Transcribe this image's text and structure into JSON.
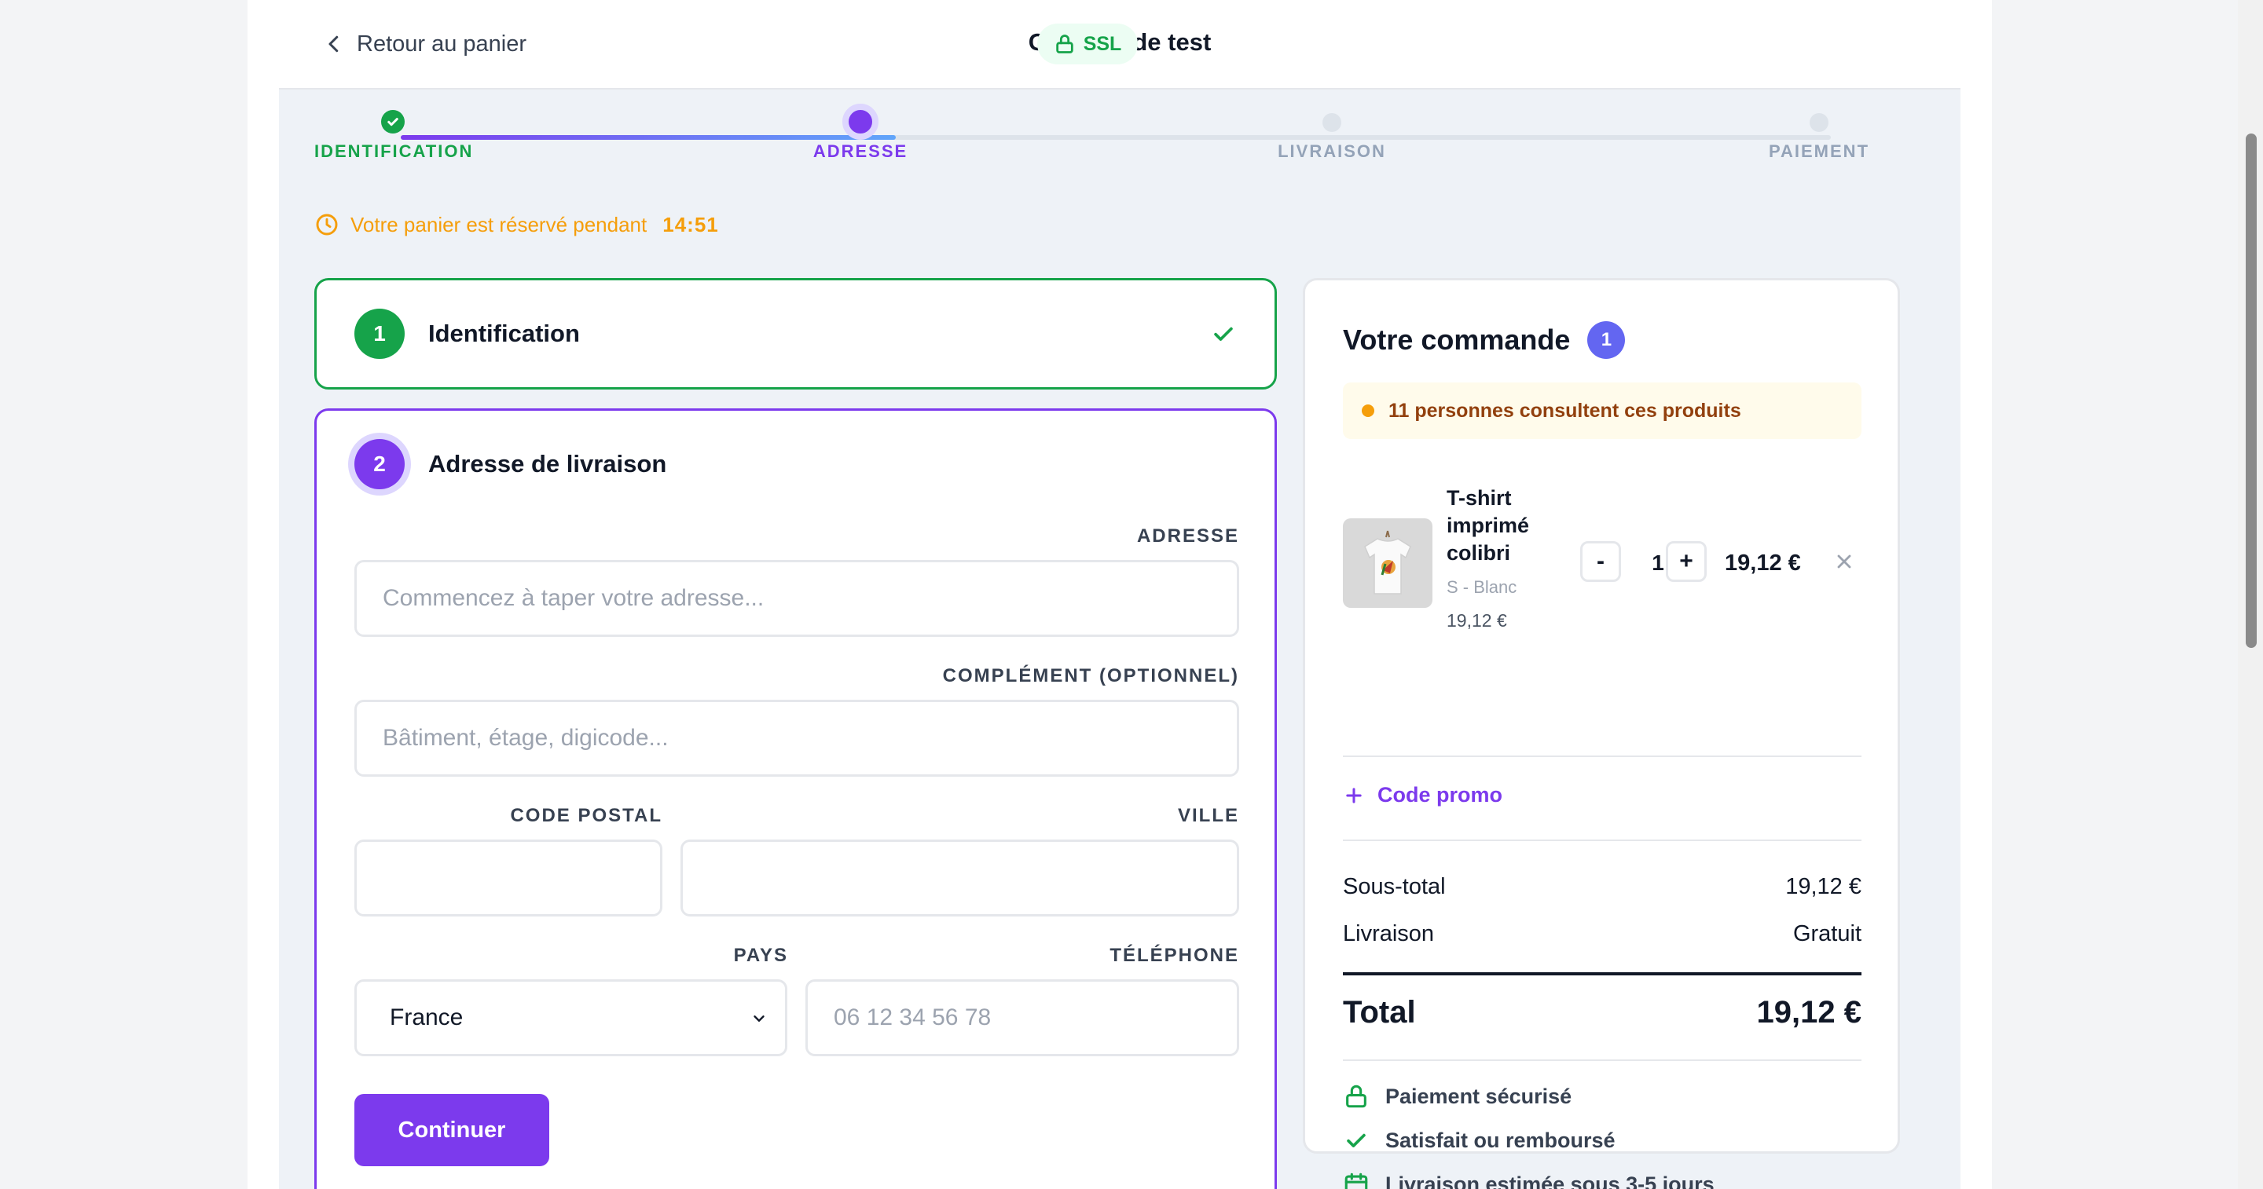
{
  "header": {
    "back_label": "Retour au panier",
    "title": "Commande test",
    "ssl_label": "SSL"
  },
  "stepper": {
    "steps": [
      {
        "label": "IDENTIFICATION",
        "state": "done"
      },
      {
        "label": "ADRESSE",
        "state": "current"
      },
      {
        "label": "LIVRAISON",
        "state": "pending"
      },
      {
        "label": "PAIEMENT",
        "state": "pending"
      }
    ]
  },
  "timer": {
    "text": "Votre panier est réservé pendant",
    "time": "14:51"
  },
  "identification_card": {
    "number": "1",
    "title": "Identification"
  },
  "address_card": {
    "number": "2",
    "title": "Adresse de livraison",
    "address_label": "ADRESSE",
    "address_placeholder": "Commencez à taper votre adresse...",
    "complement_label": "COMPLÉMENT (OPTIONNEL)",
    "complement_placeholder": "Bâtiment, étage, digicode...",
    "postal_label": "CODE POSTAL",
    "city_label": "VILLE",
    "country_label": "PAYS",
    "country_value": "France",
    "phone_label": "TÉLÉPHONE",
    "phone_placeholder": "06 12 34 56 78",
    "continue_label": "Continuer"
  },
  "order": {
    "title": "Votre commande",
    "count": "1",
    "alert": "11 personnes consultent ces produits",
    "item": {
      "name": "T-shirt imprimé colibri",
      "variant": "S - Blanc",
      "unit_price": "19,12 €",
      "minus": "-",
      "quantity": "1",
      "plus": "+",
      "line_total": "19,12 €"
    },
    "promo_label": "Code promo",
    "subtotal_label": "Sous-total",
    "subtotal_value": "19,12 €",
    "shipping_label": "Livraison",
    "shipping_value": "Gratuit",
    "total_label": "Total",
    "total_value": "19,12 €",
    "trust": [
      "Paiement sécurisé",
      "Satisfait ou remboursé",
      "Livraison estimée sous 3-5 jours"
    ]
  },
  "colors": {
    "accent": "#7c3aed",
    "success": "#16a34a",
    "warning": "#f59e0b"
  }
}
